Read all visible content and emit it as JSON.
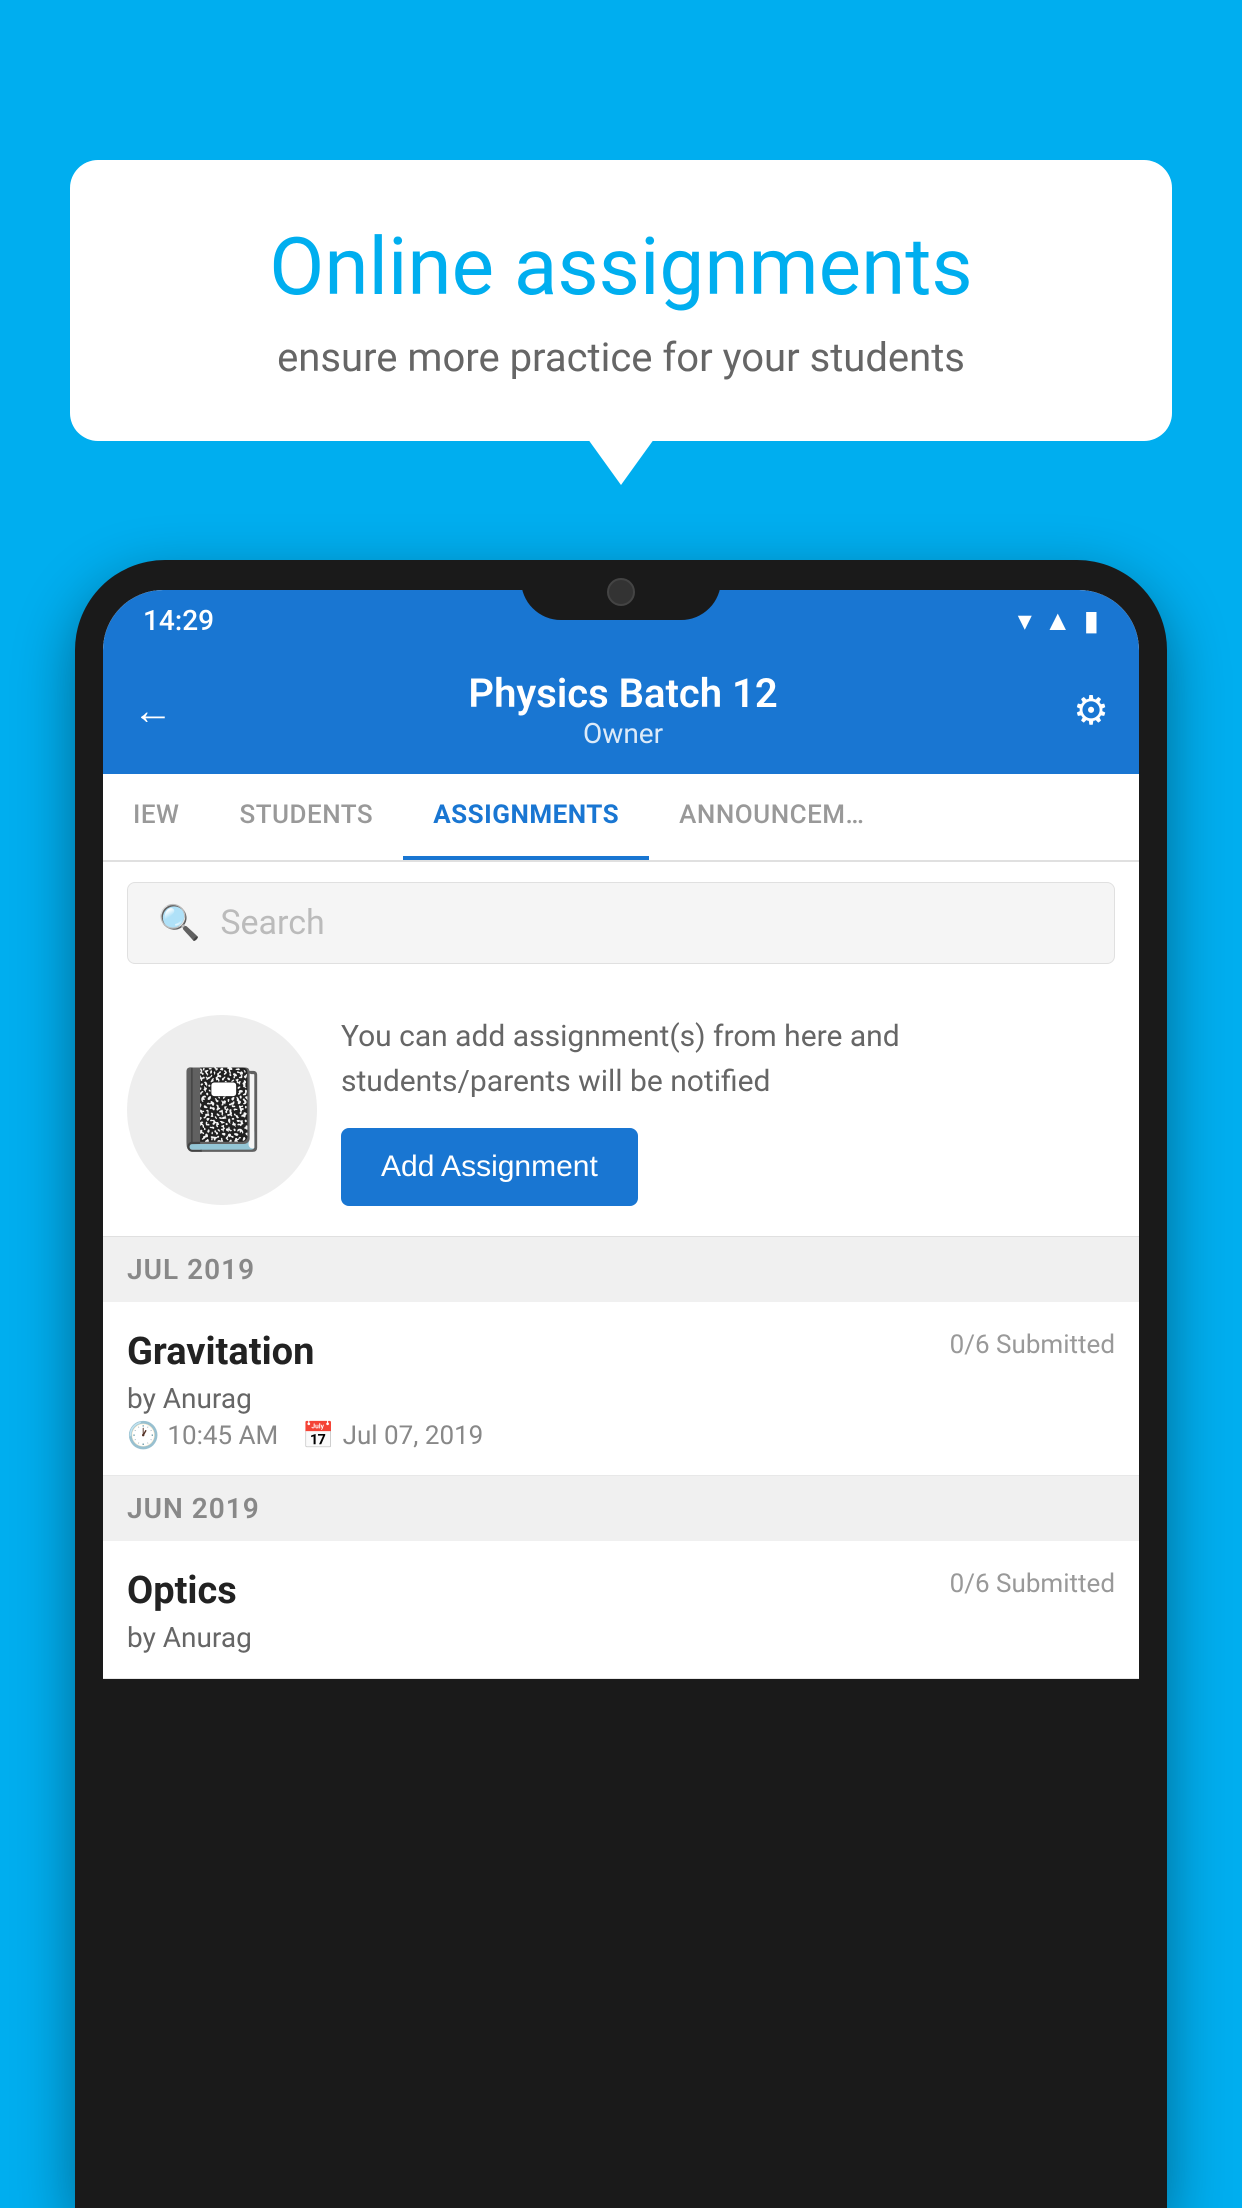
{
  "background": {
    "color": "#00AEEF"
  },
  "speech_bubble": {
    "title": "Online assignments",
    "subtitle": "ensure more practice for your students"
  },
  "status_bar": {
    "time": "14:29",
    "icons": [
      "wifi",
      "signal",
      "battery"
    ]
  },
  "app_header": {
    "title": "Physics Batch 12",
    "subtitle": "Owner",
    "back_label": "←",
    "settings_label": "⚙"
  },
  "tabs": [
    {
      "label": "IEW",
      "active": false
    },
    {
      "label": "STUDENTS",
      "active": false
    },
    {
      "label": "ASSIGNMENTS",
      "active": true
    },
    {
      "label": "ANNOUNCEM…",
      "active": false
    }
  ],
  "search": {
    "placeholder": "Search"
  },
  "promo": {
    "description": "You can add assignment(s) from here and students/parents will be notified",
    "add_button_label": "Add Assignment"
  },
  "sections": [
    {
      "label": "JUL 2019",
      "assignments": [
        {
          "title": "Gravitation",
          "submitted": "0/6 Submitted",
          "by": "by Anurag",
          "time": "10:45 AM",
          "date": "Jul 07, 2019"
        }
      ]
    },
    {
      "label": "JUN 2019",
      "assignments": [
        {
          "title": "Optics",
          "submitted": "0/6 Submitted",
          "by": "by Anurag",
          "time": "",
          "date": ""
        }
      ]
    }
  ]
}
